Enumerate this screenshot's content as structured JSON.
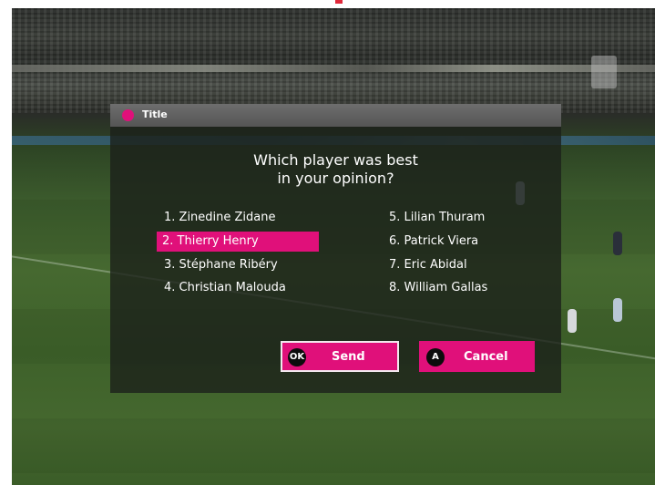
{
  "dialog": {
    "title": "Title",
    "question_line1": "Which player was best",
    "question_line2": "in your opinion?",
    "options": [
      {
        "label": "1. Zinedine Zidane",
        "selected": false
      },
      {
        "label": "2. Thierry Henry",
        "selected": true
      },
      {
        "label": "3. Stéphane Ribéry",
        "selected": false
      },
      {
        "label": "4. Christian Malouda",
        "selected": false
      },
      {
        "label": "5. Lilian Thuram",
        "selected": false
      },
      {
        "label": "6. Patrick Viera",
        "selected": false
      },
      {
        "label": "7. Eric Abidal",
        "selected": false
      },
      {
        "label": "8. William Gallas",
        "selected": false
      }
    ],
    "buttons": {
      "send": {
        "key": "OK",
        "label": "Send"
      },
      "cancel": {
        "key": "A",
        "label": "Cancel"
      }
    }
  },
  "colors": {
    "accent": "#e0107a",
    "dialog_header": "#5f5f5f",
    "dialog_body": "#1c201a"
  }
}
